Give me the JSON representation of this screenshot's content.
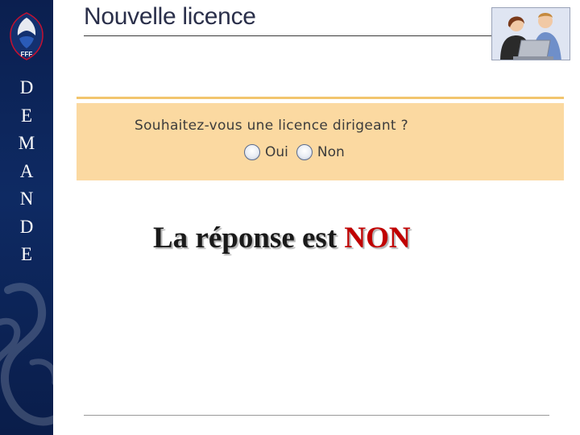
{
  "sidebar": {
    "logo_text": "FFF",
    "vertical_letters": [
      "D",
      "E",
      "M",
      "A",
      "N",
      "D",
      "E"
    ]
  },
  "header": {
    "title": "Nouvelle licence"
  },
  "form": {
    "question": "Souhaitez-vous une licence dirigeant ?",
    "options": [
      {
        "label": "Oui",
        "selected": false
      },
      {
        "label": "Non",
        "selected": false
      }
    ]
  },
  "answer": {
    "prefix": "La réponse est",
    "value": "NON"
  },
  "colors": {
    "sidebar": "#0e2a63",
    "panel": "#fbd9a1",
    "panel_line": "#f2c56e",
    "answer_highlight": "#c00000"
  },
  "icons": {
    "logo": "fff-logo-icon",
    "clipart": "office-people-clipart",
    "rooster": "rooster-watermark"
  }
}
